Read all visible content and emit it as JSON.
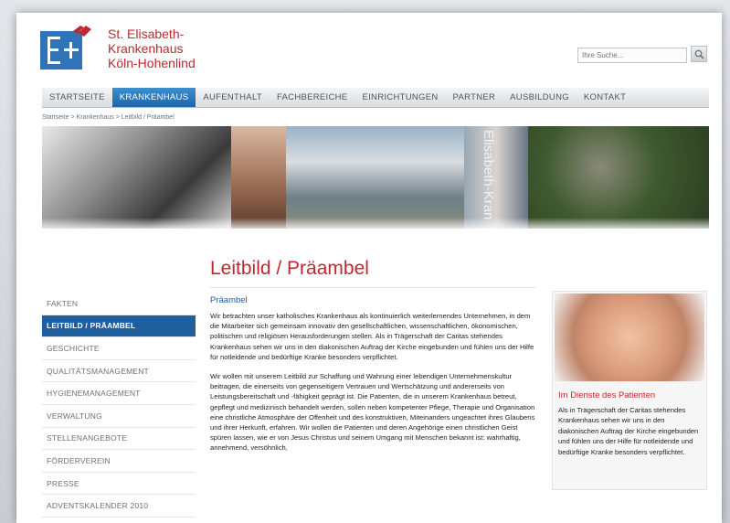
{
  "header": {
    "logo_lines": [
      "St. Elisabeth-",
      "Krankenhaus",
      "Köln-Hohenlind"
    ],
    "search_placeholder": "Ihre Suche..."
  },
  "nav": {
    "items": [
      {
        "label": "STARTSEITE",
        "active": false
      },
      {
        "label": "KRANKENHAUS",
        "active": true
      },
      {
        "label": "AUFENTHALT",
        "active": false
      },
      {
        "label": "FACHBEREICHE",
        "active": false
      },
      {
        "label": "EINRICHTUNGEN",
        "active": false
      },
      {
        "label": "PARTNER",
        "active": false
      },
      {
        "label": "AUSBILDUNG",
        "active": false
      },
      {
        "label": "KONTAKT",
        "active": false
      }
    ]
  },
  "breadcrumb": "Startseite > Krankenhaus > Leitbild / Präambel",
  "banner": {
    "vertical_text": "Elisabeth-Kran"
  },
  "page": {
    "title": "Leitbild / Präambel",
    "section_title": "Präambel",
    "paragraphs": [
      "Wir betrachten unser katholisches Krankenhaus als kontinuierlich weiterlernendes Unternehmen, in dem die Mitarbeiter sich gemeinsam innovativ den gesellschaftlichen, wissenschaftlichen, ökonomischen, politischen und religiösen Herausforderungen stellen. Als in Trägerschaft der Caritas stehendes Krankenhaus sehen wir uns in den diakonischen Auftrag der Kirche eingebunden und fühlen uns der Hilfe für notleidende und bedürftige Kranke besonders verpflichtet.",
      "Wir wollen mit unserem Leitbild zur Schaffung und Wahrung einer lebendigen Unternehmenskultur beitragen, die einerseits von gegenseitigem Vertrauen und Wertschätzung und andererseits von Leistungsbereitschaft und -fähigkeit geprägt ist. Die Patienten, die in unserem Krankenhaus betreut, gepflegt und medizinisch behandelt werden, sollen neben kompetenter Pflege, Therapie und Organisation eine christliche Atmosphäre der Offenheit und des konstruktiven, Miteinanders ungeachtet ihres Glaubens und ihrer Herkunft, erfahren. Wir wollen die Patienten und deren Angehörige einen christlichen Geist spüren lassen, wie er von Jesus Christus und seinem Umgang mit Menschen bekannt ist: wahrhaftig, annehmend, versöhnlich,"
    ]
  },
  "sidebar": {
    "items": [
      {
        "label": "FAKTEN",
        "active": false
      },
      {
        "label": "LEITBILD / PRÄAMBEL",
        "active": true
      },
      {
        "label": "GESCHICHTE",
        "active": false
      },
      {
        "label": "QUALITÄTSMANAGEMENT",
        "active": false
      },
      {
        "label": "HYGIENEMANAGEMENT",
        "active": false
      },
      {
        "label": "VERWALTUNG",
        "active": false
      },
      {
        "label": "STELLENANGEBOTE",
        "active": false
      },
      {
        "label": "FÖRDERVEREIN",
        "active": false
      },
      {
        "label": "PRESSE",
        "active": false
      },
      {
        "label": "ADVENTSKALENDER 2010",
        "active": false
      }
    ]
  },
  "rightbox": {
    "title": "Im Dienste des Patienten",
    "text": "Als in Trägerschaft der Caritas stehendes Krankenhaus sehen wir uns in den diakonischen Auftrag der Kirche eingebunden und fühlen uns der Hilfe für notleidende und bedürftige Kranke besonders verpflichtet."
  },
  "colors": {
    "brand_red": "#c0282f",
    "brand_blue": "#1f5f9d",
    "nav_active": "#2a79bc"
  }
}
